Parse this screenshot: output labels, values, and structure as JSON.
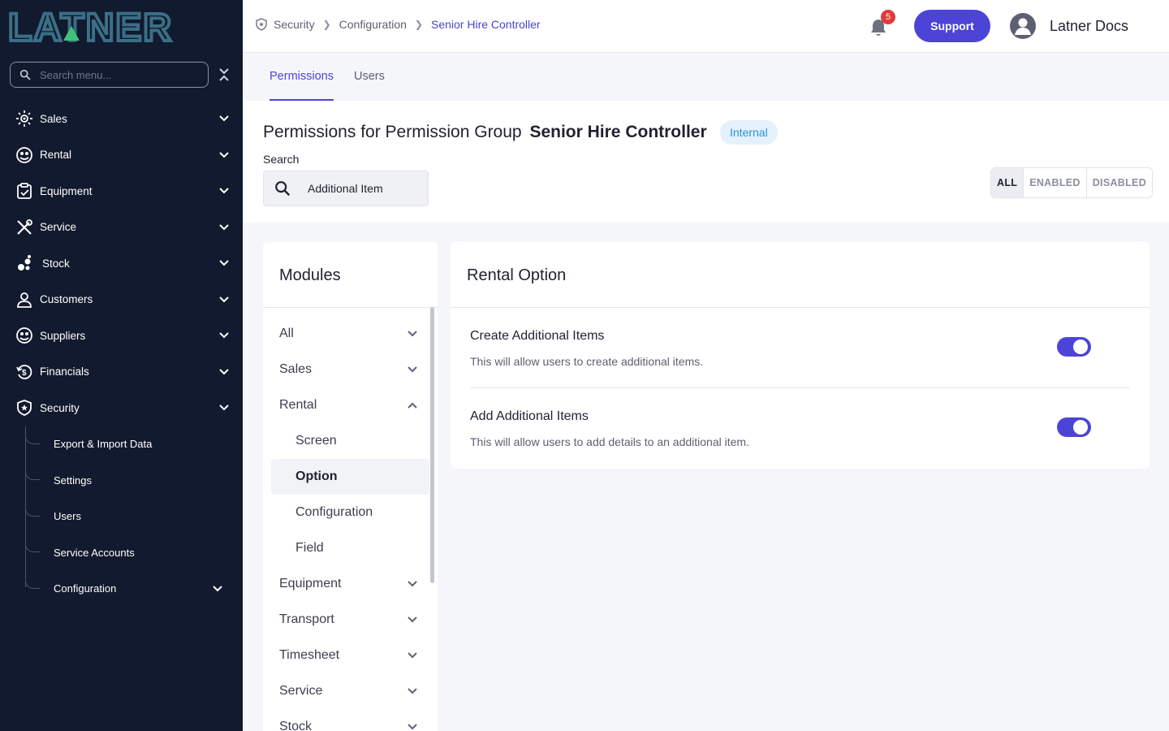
{
  "brand": {
    "logo_text": "LATNER",
    "accent": "#4b44d6",
    "sidebar_bg": "#111a2e"
  },
  "sidebar": {
    "search_placeholder": "Search menu...",
    "items": [
      {
        "label": "Sales",
        "icon": "sales-icon"
      },
      {
        "label": "Rental",
        "icon": "rental-icon"
      },
      {
        "label": "Equipment",
        "icon": "equipment-icon"
      },
      {
        "label": "Service",
        "icon": "service-icon"
      },
      {
        "label": "Stock",
        "icon": "stock-icon"
      },
      {
        "label": "Customers",
        "icon": "user-icon"
      },
      {
        "label": "Suppliers",
        "icon": "suppliers-icon"
      },
      {
        "label": "Financials",
        "icon": "financials-icon"
      },
      {
        "label": "Security",
        "icon": "shield-icon"
      }
    ],
    "security_subitems": [
      {
        "label": "Export & Import Data"
      },
      {
        "label": "Settings"
      },
      {
        "label": "Users"
      },
      {
        "label": "Service Accounts"
      },
      {
        "label": "Configuration"
      }
    ]
  },
  "header": {
    "breadcrumb": [
      "Security",
      "Configuration",
      "Senior Hire Controller"
    ],
    "notification_count": "5",
    "support_label": "Support",
    "user_name": "Latner Docs"
  },
  "tabs": [
    {
      "label": "Permissions",
      "active": true
    },
    {
      "label": "Users",
      "active": false
    }
  ],
  "page": {
    "title_prefix": "Permissions for Permission Group",
    "group_name": "Senior Hire Controller",
    "group_type": "Internal",
    "search_label": "Search",
    "search_value": "Additional Item",
    "filters": [
      {
        "label": "ALL",
        "active": true
      },
      {
        "label": "ENABLED",
        "active": false
      },
      {
        "label": "DISABLED",
        "active": false
      }
    ]
  },
  "modules": {
    "title": "Modules",
    "items": [
      {
        "label": "All",
        "expanded": false
      },
      {
        "label": "Sales",
        "expanded": false
      },
      {
        "label": "Rental",
        "expanded": true
      },
      {
        "label": "Equipment",
        "expanded": false
      },
      {
        "label": "Transport",
        "expanded": false
      },
      {
        "label": "Timesheet",
        "expanded": false
      },
      {
        "label": "Service",
        "expanded": false
      },
      {
        "label": "Stock",
        "expanded": false
      }
    ],
    "rental_subitems": [
      "Screen",
      "Option",
      "Configuration",
      "Field"
    ],
    "selected_subitem": "Option"
  },
  "option_panel": {
    "title": "Rental Option",
    "permissions": [
      {
        "name": "Create Additional Items",
        "description": "This will allow users to create additional items.",
        "enabled": true
      },
      {
        "name": "Add Additional Items",
        "description": "This will allow users to add details to an additional item.",
        "enabled": true
      }
    ]
  }
}
